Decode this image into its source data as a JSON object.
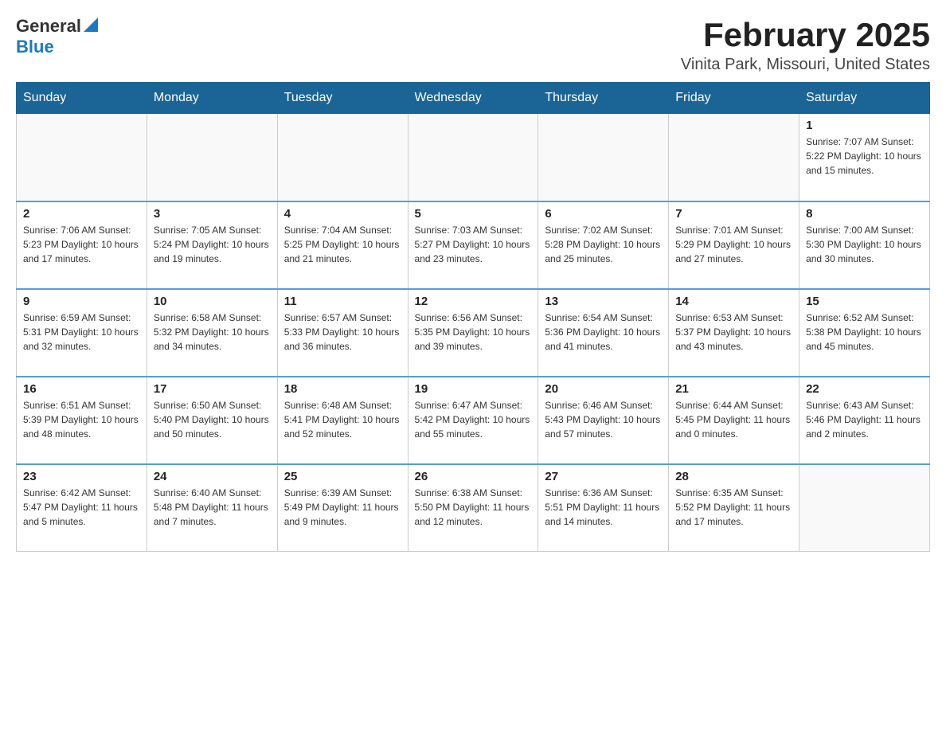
{
  "header": {
    "logo_general": "General",
    "logo_blue": "Blue",
    "title": "February 2025",
    "subtitle": "Vinita Park, Missouri, United States"
  },
  "weekdays": [
    "Sunday",
    "Monday",
    "Tuesday",
    "Wednesday",
    "Thursday",
    "Friday",
    "Saturday"
  ],
  "weeks": [
    [
      {
        "day": "",
        "info": ""
      },
      {
        "day": "",
        "info": ""
      },
      {
        "day": "",
        "info": ""
      },
      {
        "day": "",
        "info": ""
      },
      {
        "day": "",
        "info": ""
      },
      {
        "day": "",
        "info": ""
      },
      {
        "day": "1",
        "info": "Sunrise: 7:07 AM\nSunset: 5:22 PM\nDaylight: 10 hours and 15 minutes."
      }
    ],
    [
      {
        "day": "2",
        "info": "Sunrise: 7:06 AM\nSunset: 5:23 PM\nDaylight: 10 hours and 17 minutes."
      },
      {
        "day": "3",
        "info": "Sunrise: 7:05 AM\nSunset: 5:24 PM\nDaylight: 10 hours and 19 minutes."
      },
      {
        "day": "4",
        "info": "Sunrise: 7:04 AM\nSunset: 5:25 PM\nDaylight: 10 hours and 21 minutes."
      },
      {
        "day": "5",
        "info": "Sunrise: 7:03 AM\nSunset: 5:27 PM\nDaylight: 10 hours and 23 minutes."
      },
      {
        "day": "6",
        "info": "Sunrise: 7:02 AM\nSunset: 5:28 PM\nDaylight: 10 hours and 25 minutes."
      },
      {
        "day": "7",
        "info": "Sunrise: 7:01 AM\nSunset: 5:29 PM\nDaylight: 10 hours and 27 minutes."
      },
      {
        "day": "8",
        "info": "Sunrise: 7:00 AM\nSunset: 5:30 PM\nDaylight: 10 hours and 30 minutes."
      }
    ],
    [
      {
        "day": "9",
        "info": "Sunrise: 6:59 AM\nSunset: 5:31 PM\nDaylight: 10 hours and 32 minutes."
      },
      {
        "day": "10",
        "info": "Sunrise: 6:58 AM\nSunset: 5:32 PM\nDaylight: 10 hours and 34 minutes."
      },
      {
        "day": "11",
        "info": "Sunrise: 6:57 AM\nSunset: 5:33 PM\nDaylight: 10 hours and 36 minutes."
      },
      {
        "day": "12",
        "info": "Sunrise: 6:56 AM\nSunset: 5:35 PM\nDaylight: 10 hours and 39 minutes."
      },
      {
        "day": "13",
        "info": "Sunrise: 6:54 AM\nSunset: 5:36 PM\nDaylight: 10 hours and 41 minutes."
      },
      {
        "day": "14",
        "info": "Sunrise: 6:53 AM\nSunset: 5:37 PM\nDaylight: 10 hours and 43 minutes."
      },
      {
        "day": "15",
        "info": "Sunrise: 6:52 AM\nSunset: 5:38 PM\nDaylight: 10 hours and 45 minutes."
      }
    ],
    [
      {
        "day": "16",
        "info": "Sunrise: 6:51 AM\nSunset: 5:39 PM\nDaylight: 10 hours and 48 minutes."
      },
      {
        "day": "17",
        "info": "Sunrise: 6:50 AM\nSunset: 5:40 PM\nDaylight: 10 hours and 50 minutes."
      },
      {
        "day": "18",
        "info": "Sunrise: 6:48 AM\nSunset: 5:41 PM\nDaylight: 10 hours and 52 minutes."
      },
      {
        "day": "19",
        "info": "Sunrise: 6:47 AM\nSunset: 5:42 PM\nDaylight: 10 hours and 55 minutes."
      },
      {
        "day": "20",
        "info": "Sunrise: 6:46 AM\nSunset: 5:43 PM\nDaylight: 10 hours and 57 minutes."
      },
      {
        "day": "21",
        "info": "Sunrise: 6:44 AM\nSunset: 5:45 PM\nDaylight: 11 hours and 0 minutes."
      },
      {
        "day": "22",
        "info": "Sunrise: 6:43 AM\nSunset: 5:46 PM\nDaylight: 11 hours and 2 minutes."
      }
    ],
    [
      {
        "day": "23",
        "info": "Sunrise: 6:42 AM\nSunset: 5:47 PM\nDaylight: 11 hours and 5 minutes."
      },
      {
        "day": "24",
        "info": "Sunrise: 6:40 AM\nSunset: 5:48 PM\nDaylight: 11 hours and 7 minutes."
      },
      {
        "day": "25",
        "info": "Sunrise: 6:39 AM\nSunset: 5:49 PM\nDaylight: 11 hours and 9 minutes."
      },
      {
        "day": "26",
        "info": "Sunrise: 6:38 AM\nSunset: 5:50 PM\nDaylight: 11 hours and 12 minutes."
      },
      {
        "day": "27",
        "info": "Sunrise: 6:36 AM\nSunset: 5:51 PM\nDaylight: 11 hours and 14 minutes."
      },
      {
        "day": "28",
        "info": "Sunrise: 6:35 AM\nSunset: 5:52 PM\nDaylight: 11 hours and 17 minutes."
      },
      {
        "day": "",
        "info": ""
      }
    ]
  ]
}
